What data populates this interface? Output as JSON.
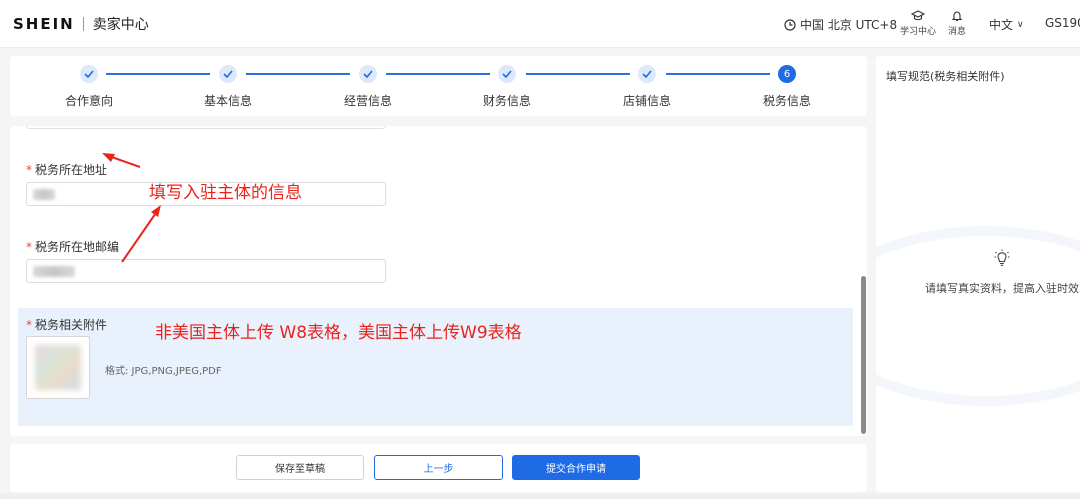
{
  "header": {
    "logo": "SHEIN",
    "app_name": "卖家中心",
    "timezone": "中国 北京 UTC+8",
    "learning_center": "学习中心",
    "messages": "消息",
    "language": "中文",
    "account": "GS190"
  },
  "stepper": {
    "steps": [
      {
        "label": "合作意向",
        "status": "done"
      },
      {
        "label": "基本信息",
        "status": "done"
      },
      {
        "label": "经营信息",
        "status": "done"
      },
      {
        "label": "财务信息",
        "status": "done"
      },
      {
        "label": "店铺信息",
        "status": "done"
      },
      {
        "label": "税务信息",
        "status": "active",
        "number": "6"
      }
    ]
  },
  "form": {
    "tax_address": {
      "required_mark": "*",
      "label": "税务所在地址"
    },
    "tax_postcode": {
      "required_mark": "*",
      "label": "税务所在地邮编"
    },
    "attachment": {
      "required_mark": "*",
      "label": "税务相关附件",
      "format_hint": "格式: JPG,PNG,JPEG,PDF"
    }
  },
  "annotations": {
    "fill_entity": "填写入驻主体的信息",
    "upload_forms": "非美国主体上传 W8表格，美国主体上传W9表格"
  },
  "actions": {
    "save_draft": "保存至草稿",
    "previous": "上一步",
    "submit": "提交合作申请"
  },
  "side_panel": {
    "title": "填写规范(税务相关附件)",
    "tip": "请填写真实资料，提高入驻时效"
  },
  "colors": {
    "primary": "#1f6be6",
    "required": "#e24b3b",
    "annotation": "#e8241b",
    "highlight_bg": "#e9f1fc"
  }
}
